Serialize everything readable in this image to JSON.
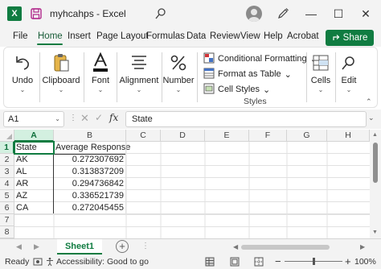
{
  "titlebar": {
    "app_logo_letter": "X",
    "title": "myhcahps  -  Excel",
    "minimize": "—",
    "maximize": "☐",
    "close": "✕"
  },
  "menu": {
    "tabs": [
      "File",
      "Home",
      "Insert",
      "Page Layout",
      "Formulas",
      "Data",
      "Review",
      "View",
      "Help",
      "Acrobat"
    ],
    "active_tab": "Home",
    "share_label": "Share"
  },
  "ribbon": {
    "undo_label": "Undo",
    "clipboard_label": "Clipboard",
    "font_label": "Font",
    "alignment_label": "Alignment",
    "number_label": "Number",
    "styles": {
      "conditional_formatting": "Conditional Formatting",
      "format_as_table": "Format as Table",
      "cell_styles": "Cell Styles",
      "group_caption": "Styles"
    },
    "cells_label": "Cells",
    "editing_label": "Edit"
  },
  "formula_bar": {
    "name_box": "A1",
    "fx": "fx",
    "value": "State"
  },
  "grid": {
    "columns": [
      "A",
      "B",
      "C",
      "D",
      "E",
      "F",
      "G",
      "H"
    ],
    "rows": [
      "1",
      "2",
      "3",
      "4",
      "5",
      "6",
      "7",
      "8"
    ],
    "header_row": [
      "State",
      "Average Response"
    ],
    "data": [
      [
        "AK",
        "0.272307692"
      ],
      [
        "AL",
        "0.313837209"
      ],
      [
        "AR",
        "0.294736842"
      ],
      [
        "AZ",
        "0.336521739"
      ],
      [
        "CA",
        "0.272045455"
      ]
    ]
  },
  "sheets": {
    "active": "Sheet1",
    "add": "+"
  },
  "status": {
    "ready": "Ready",
    "accessibility": "Accessibility: Good to go",
    "zoom": "100%",
    "zoom_minus": "−",
    "zoom_plus": "+"
  },
  "colors": {
    "accent": "#107c41",
    "selection_header_bg": "#d3f0e0"
  }
}
